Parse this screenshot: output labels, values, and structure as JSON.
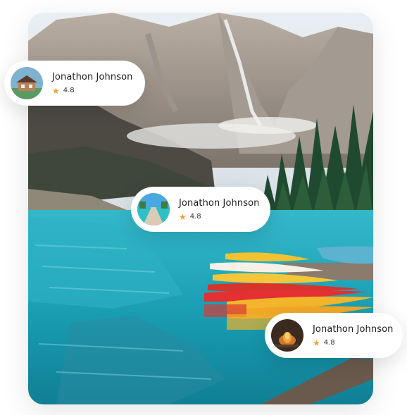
{
  "reviews": [
    {
      "name": "Jonathon Johnson",
      "rating": "4.8",
      "avatar": "cabin-avatar"
    },
    {
      "name": "Jonathon Johnson",
      "rating": "4.8",
      "avatar": "boardwalk-avatar"
    },
    {
      "name": "Jonathon Johnson",
      "rating": "4.8",
      "avatar": "campfire-avatar"
    }
  ],
  "colors": {
    "star": "#f0a22b",
    "lake": "#1aa3b8",
    "card_bg": "#ffffff"
  },
  "photo": {
    "subject": "mountain-lake-canoes"
  }
}
